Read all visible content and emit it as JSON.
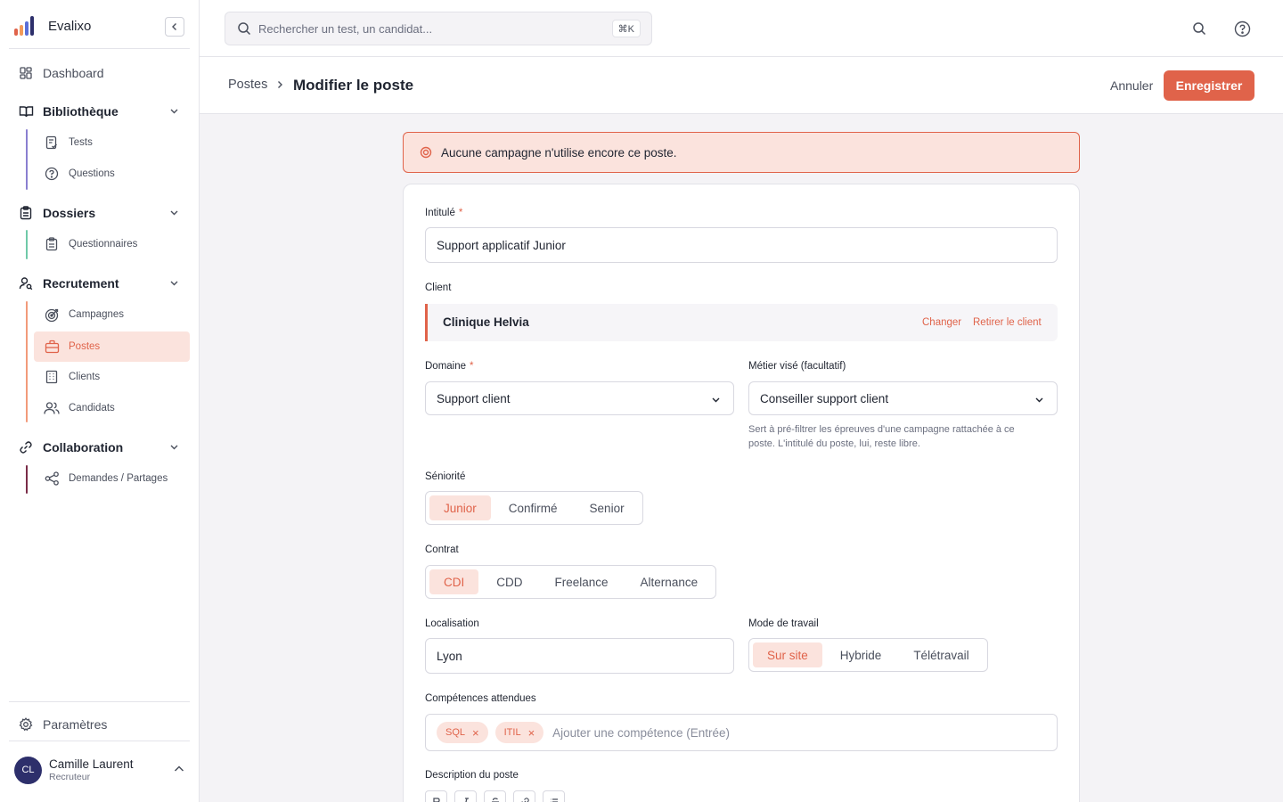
{
  "app": {
    "name": "Evalixo"
  },
  "colors": {
    "accent": "#e0634a",
    "accent_soft": "#fbe3dd",
    "avatar_bg": "#2d2f6b"
  },
  "sidebar": {
    "dashboard": "Dashboard",
    "sections": [
      {
        "label": "Bibliothèque",
        "items": [
          "Tests",
          "Questions"
        ]
      },
      {
        "label": "Dossiers",
        "items": [
          "Questionnaires"
        ]
      },
      {
        "label": "Recrutement",
        "items": [
          "Campagnes",
          "Postes",
          "Clients",
          "Candidats"
        ]
      },
      {
        "label": "Collaboration",
        "items": [
          "Demandes / Partages"
        ]
      }
    ],
    "active_item": "Postes",
    "settings": "Paramètres",
    "user": {
      "initials": "CL",
      "name": "Camille Laurent",
      "role": "Recruteur"
    }
  },
  "topbar": {
    "search_placeholder": "Rechercher un test, un candidat...",
    "shortcut": "⌘K"
  },
  "header": {
    "breadcrumb_parent": "Postes",
    "title": "Modifier le poste",
    "cancel": "Annuler",
    "save": "Enregistrer"
  },
  "alert": {
    "text": "Aucune campagne n'utilise encore ce poste."
  },
  "form": {
    "title_label": "Intitulé",
    "title_value": "Support applicatif Junior",
    "client_label": "Client",
    "client_name": "Clinique Helvia",
    "client_change": "Changer",
    "client_remove": "Retirer le client",
    "domain_label": "Domaine",
    "domain_value": "Support client",
    "job_label": "Métier visé (facultatif)",
    "job_value": "Conseiller support client",
    "job_help": "Sert à pré-filtrer les épreuves d'une campagne rattachée à ce poste. L'intitulé du poste, lui, reste libre.",
    "seniority_label": "Séniorité",
    "seniority_options": [
      "Junior",
      "Confirmé",
      "Senior"
    ],
    "seniority_selected": "Junior",
    "contract_label": "Contrat",
    "contract_options": [
      "CDI",
      "CDD",
      "Freelance",
      "Alternance"
    ],
    "contract_selected": "CDI",
    "location_label": "Localisation",
    "location_value": "Lyon",
    "workmode_label": "Mode de travail",
    "workmode_options": [
      "Sur site",
      "Hybride",
      "Télétravail"
    ],
    "workmode_selected": "Sur site",
    "skills_label": "Compétences attendues",
    "skills": [
      "SQL",
      "ITIL"
    ],
    "skills_placeholder": "Ajouter une compétence (Entrée)",
    "description_label": "Description du poste",
    "required_mark": "*"
  }
}
